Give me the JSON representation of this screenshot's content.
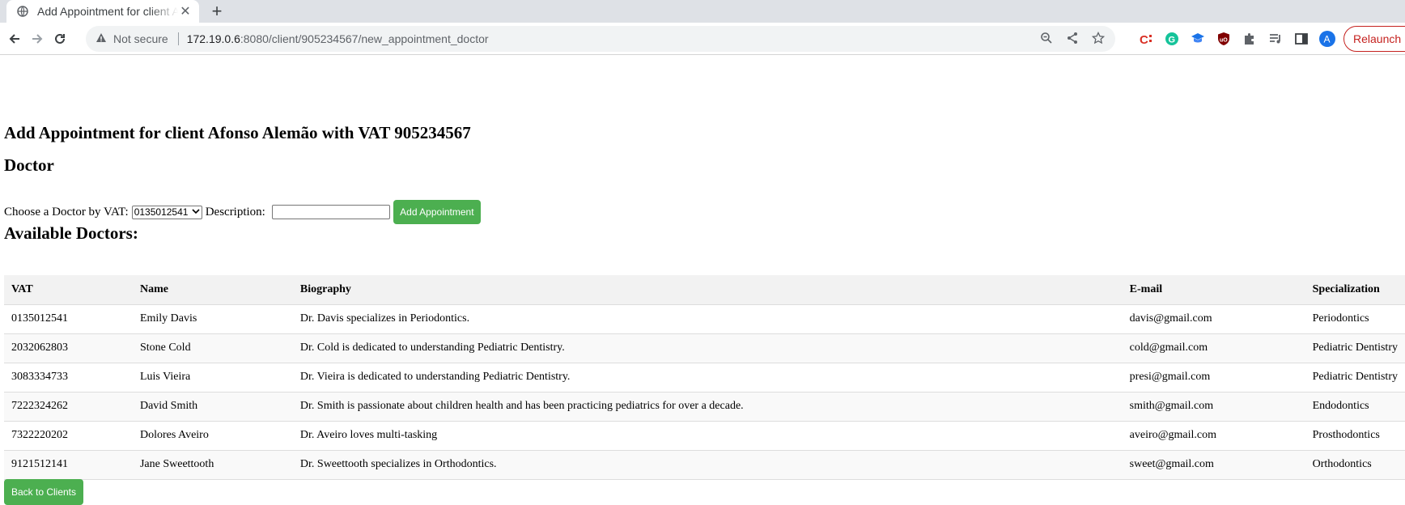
{
  "browser": {
    "tab_title": "Add Appointment for client Afonso Alemão",
    "not_secure": "Not secure",
    "url_host": "172.19.0.6",
    "url_rest": ":8080/client/905234567/new_appointment_doctor",
    "relaunch": "Relaunch",
    "profile_initial": "A"
  },
  "page": {
    "title": "Add Appointment for client Afonso Alemão with VAT 905234567",
    "doctor_heading": "Doctor",
    "form": {
      "choose_label": "Choose a Doctor by VAT:",
      "selected_vat": "0135012541",
      "description_label": "Description:",
      "description_value": "",
      "submit": "Add Appointment"
    },
    "available_heading": "Available Doctors:",
    "table": {
      "headers": [
        "VAT",
        "Name",
        "Biography",
        "E-mail",
        "Specialization"
      ],
      "rows": [
        [
          "0135012541",
          "Emily Davis",
          "Dr. Davis specializes in Periodontics.",
          "davis@gmail.com",
          "Periodontics"
        ],
        [
          "2032062803",
          "Stone Cold",
          "Dr. Cold is dedicated to understanding Pediatric Dentistry.",
          "cold@gmail.com",
          "Pediatric Dentistry"
        ],
        [
          "3083334733",
          "Luis Vieira",
          "Dr. Vieira is dedicated to understanding Pediatric Dentistry.",
          "presi@gmail.com",
          "Pediatric Dentistry"
        ],
        [
          "7222324262",
          "David Smith",
          "Dr. Smith is passionate about children health and has been practicing pediatrics for over a decade.",
          "smith@gmail.com",
          "Endodontics"
        ],
        [
          "7322220202",
          "Dolores Aveiro",
          "Dr. Aveiro loves multi-tasking",
          "aveiro@gmail.com",
          "Prosthodontics"
        ],
        [
          "9121512141",
          "Jane Sweettooth",
          "Dr. Sweettooth specializes in Orthodontics.",
          "sweet@gmail.com",
          "Orthodontics"
        ]
      ]
    },
    "back_button": "Back to Clients"
  },
  "colors": {
    "button_green": "#4caf50",
    "header_bg": "#f2f2f2",
    "row_alt_bg": "#f9f9f9"
  }
}
